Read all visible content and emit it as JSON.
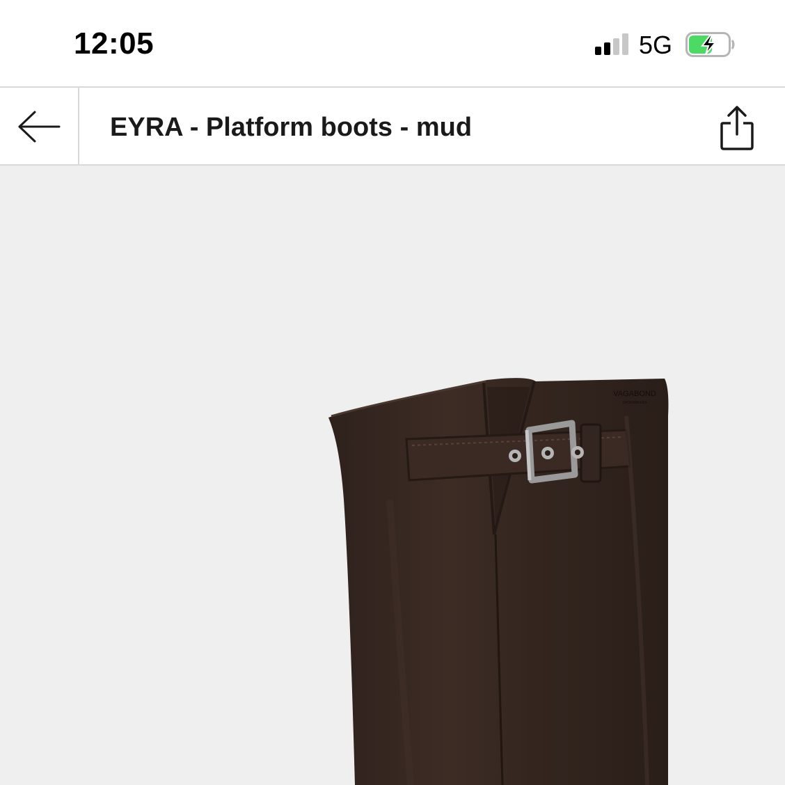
{
  "status_bar": {
    "time": "12:05",
    "network": "5G",
    "signal_bars_active": 2,
    "signal_bars_total": 4,
    "battery_state": "charging",
    "battery_level": 0.55,
    "icons": [
      "signal-icon",
      "battery-charging-icon"
    ]
  },
  "nav": {
    "back_icon": "arrow-left-icon",
    "title": "EYRA - Platform boots - mud",
    "share_icon": "share-icon"
  },
  "product": {
    "image_description_icon": "boot-image",
    "brand_mark": "VAGABOND",
    "brand_sub": "SHOEMAKERS"
  },
  "colors": {
    "background": "#efefef",
    "boot_leather": "#3a2a24",
    "battery_fill": "#4cd964",
    "divider": "#d9d9d9"
  }
}
